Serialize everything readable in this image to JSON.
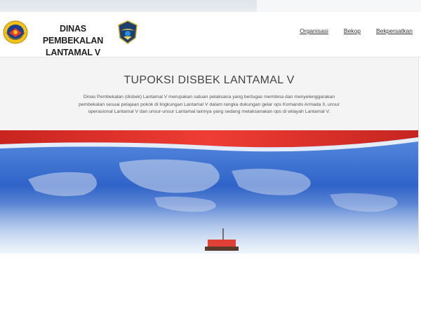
{
  "brand": {
    "line1": "DINAS PEMBEKALAN",
    "line2": "LANTAMAL V"
  },
  "nav": {
    "items": [
      "Organisasi",
      "Bekop",
      "Bekpersatkan"
    ]
  },
  "hero": {
    "title": "TUPOKSI DISBEK LANTAMAL V",
    "description": "Dinas Pembekalan (disbek) Lantamal V merupakan satuan pelaksana yang bertugas membina dan menyelenggarakan pembekalan sesuai pelajaan pokok di lingkungan Lantamal V dalam rangka dukungan gelar ops Komando Armada II, unsur operasional Lantamal V dan unsur-unsur Lantamal lainnya yang sedang melaksanakan ops di wilayah Lantamal V."
  },
  "colors": {
    "flag_red": "#e0302c",
    "sea_blue": "#3a6fd0",
    "header_bg": "#ffffff",
    "hero_bg": "#f4f4f4"
  },
  "icons": {
    "left_logo": "lantamal-emblem-icon",
    "right_logo": "navy-wings-emblem-icon"
  }
}
